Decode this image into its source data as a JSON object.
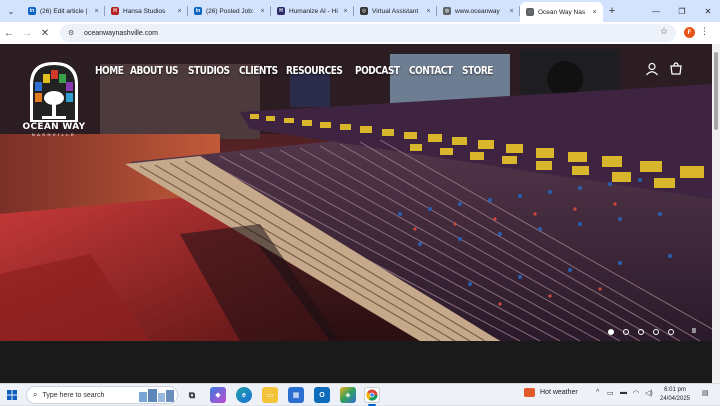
{
  "browser": {
    "tabs": [
      {
        "label": "(26) Edit article |",
        "icon": "linkedin-icon",
        "color": "#0a66c2",
        "glyph": "in"
      },
      {
        "label": "Hansa Studios",
        "icon": "hansa-icon",
        "color": "#b22222",
        "glyph": "H"
      },
      {
        "label": "(26) Posted Job:",
        "icon": "linkedin-icon",
        "color": "#0a66c2",
        "glyph": "in"
      },
      {
        "label": "Humanize AI - Hi",
        "icon": "humanize-icon",
        "color": "#2b2b6b",
        "glyph": "H"
      },
      {
        "label": "Virtual Assistant",
        "icon": "globe-icon",
        "color": "#333333",
        "glyph": "◎"
      },
      {
        "label": "www.oceanway",
        "icon": "globe-icon",
        "color": "#5f6368",
        "glyph": "◍"
      },
      {
        "label": "Ocean Way Nas",
        "icon": "loading-icon",
        "color": "#5f6368",
        "glyph": "◌"
      }
    ],
    "url": "oceanwaynashville.com",
    "profile_initial": "F"
  },
  "site": {
    "logo_name": "OCEAN WAY",
    "logo_sub": "NASHVILLE",
    "nav": [
      "HOME",
      "ABOUT US",
      "STUDIOS",
      "CLIENTS",
      "RESOURCES",
      "PODCAST",
      "CONTACT",
      "STORE"
    ],
    "slider": {
      "slide_count": 5,
      "active_index": 0,
      "pause_glyph": "II"
    }
  },
  "taskbar": {
    "search_placeholder": "Type here to search",
    "weather": "Hot weather",
    "time": "6:01 pm",
    "date": "24/04/2025"
  }
}
